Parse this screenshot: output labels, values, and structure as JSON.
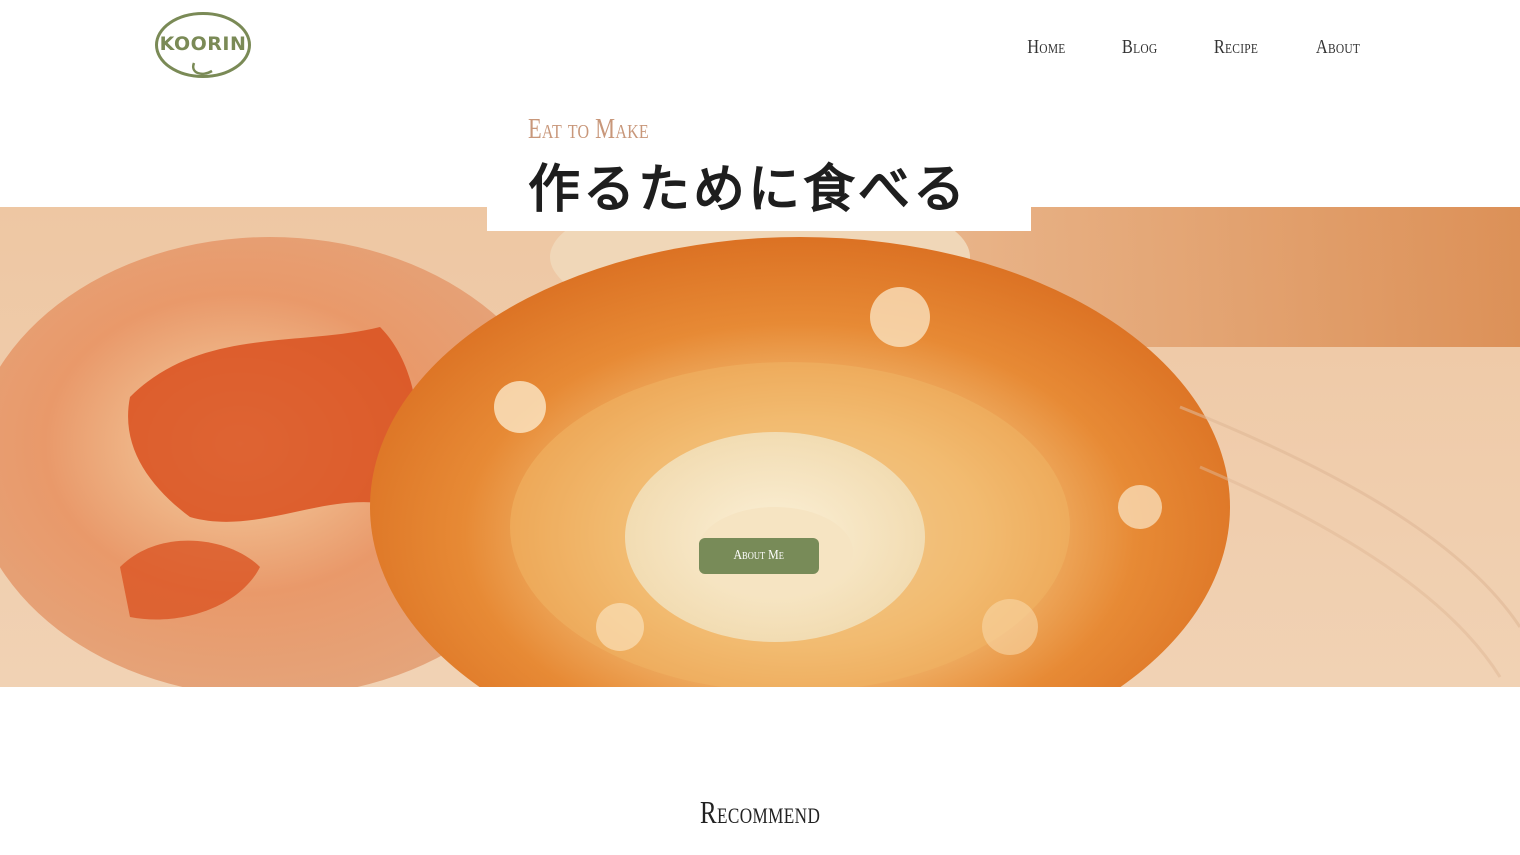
{
  "header": {
    "logo_text": "KOORIN",
    "nav": [
      {
        "label": "Home"
      },
      {
        "label": "Blog"
      },
      {
        "label": "Recipe"
      },
      {
        "label": "About"
      }
    ]
  },
  "hero": {
    "subtitle": "Eat to Make",
    "title": "作るために食べる",
    "button_label": "About Me",
    "image_icon": "bagel-photo"
  },
  "recommend": {
    "title": "Recommend"
  },
  "colors": {
    "accent_green": "#788b58",
    "logo_green": "#7a8a56",
    "subtitle_tan": "#c8977a"
  }
}
